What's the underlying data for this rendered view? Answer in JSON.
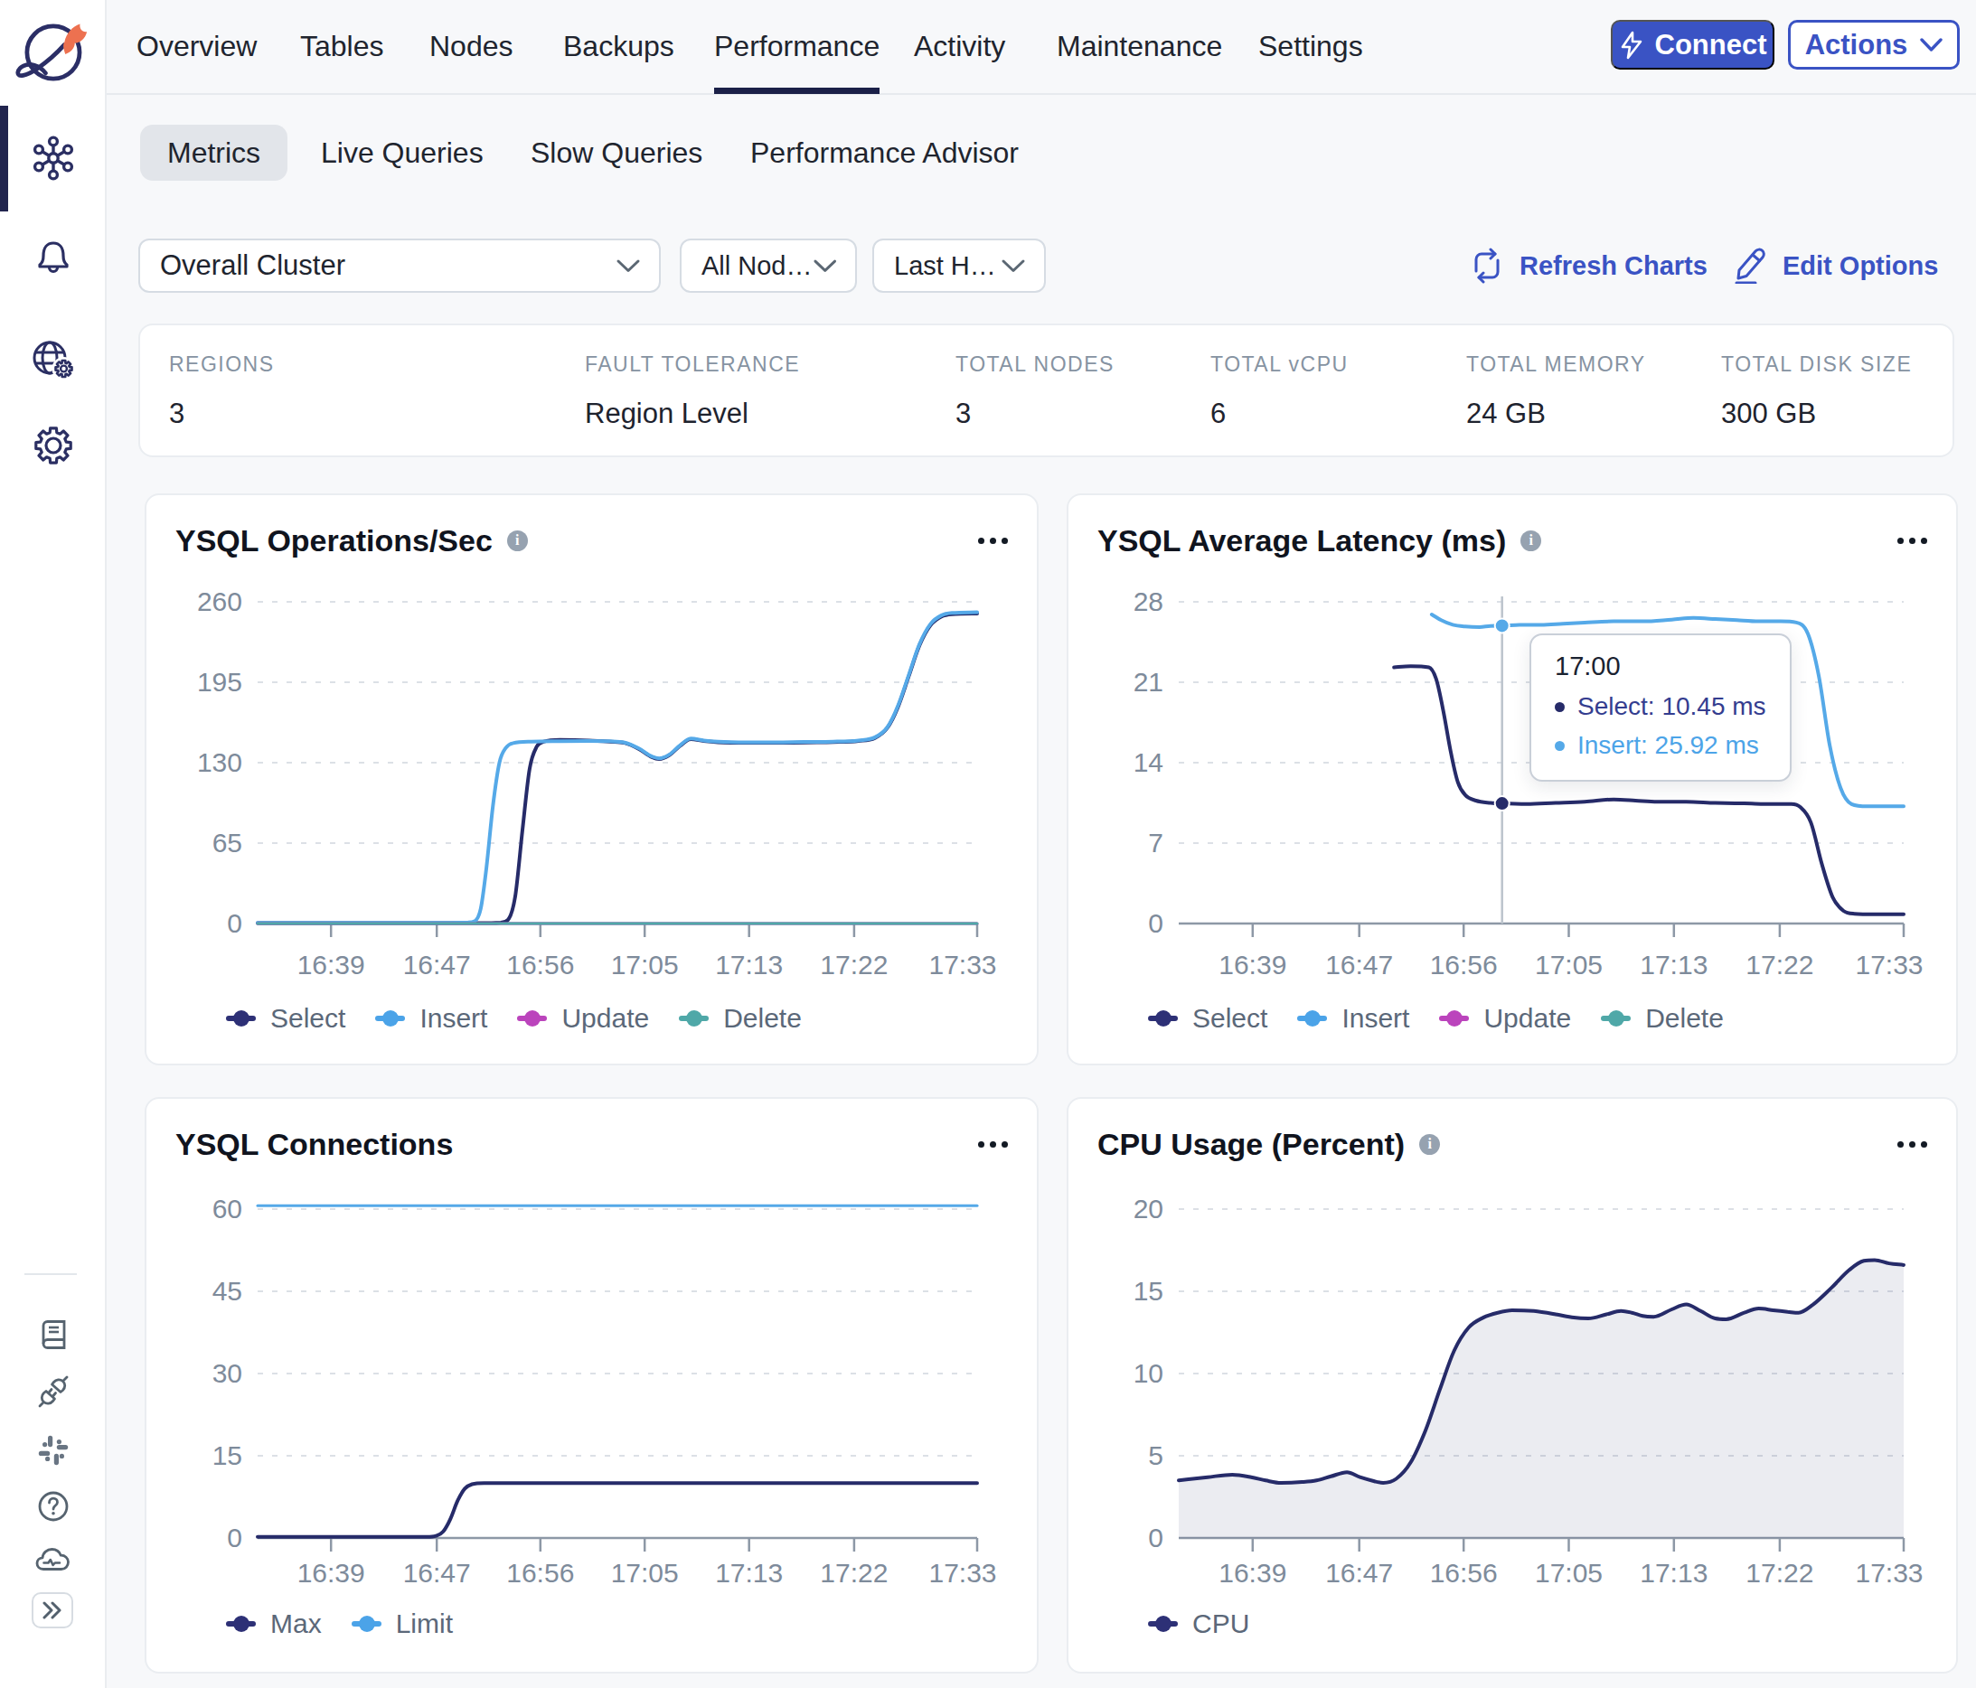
{
  "colors": {
    "accent": "#3A53C4",
    "underline": "#1B2048",
    "page_bg": "#F7F8FA",
    "navy": "#282D6E",
    "light_blue": "#4FA8E8",
    "magenta": "#BB44BC",
    "teal": "#4FA8A8",
    "axis": "#8D98A6",
    "grid": "#DCE0E6"
  },
  "sidebar": {
    "icons_top": [
      "cluster",
      "notifications",
      "network-settings",
      "settings"
    ],
    "icons_bottom": [
      "docs",
      "integrations",
      "slack",
      "help",
      "cloud-status"
    ],
    "expand_label": "expand"
  },
  "nav": {
    "tabs": [
      "Overview",
      "Tables",
      "Nodes",
      "Backups",
      "Performance",
      "Activity",
      "Maintenance",
      "Settings"
    ],
    "active_tab": "Performance",
    "connect_label": "Connect",
    "actions_label": "Actions"
  },
  "subtabs": {
    "items": [
      "Metrics",
      "Live Queries",
      "Slow Queries",
      "Performance Advisor"
    ],
    "active": "Metrics"
  },
  "filters": {
    "cluster_value": "Overall Cluster",
    "nodes_value": "All Nod…",
    "range_value": "Last H…",
    "refresh_label": "Refresh Charts",
    "edit_label": "Edit Options"
  },
  "stats": {
    "items": [
      {
        "label": "REGIONS",
        "value": "3"
      },
      {
        "label": "FAULT TOLERANCE",
        "value": "Region Level"
      },
      {
        "label": "TOTAL NODES",
        "value": "3"
      },
      {
        "label": "TOTAL vCPU",
        "value": "6"
      },
      {
        "label": "TOTAL MEMORY",
        "value": "24 GB"
      },
      {
        "label": "TOTAL DISK SIZE",
        "value": "300 GB"
      }
    ]
  },
  "chart_data": [
    {
      "id": "ysql-ops",
      "type": "line",
      "title": "YSQL Operations/Sec",
      "has_info": true,
      "y_max": 260,
      "y_ticks": [
        0,
        65,
        130,
        195,
        260
      ],
      "x_tick_labels": [
        "16:39",
        "16:47",
        "16:56",
        "17:05",
        "17:13",
        "17:22",
        "17:33"
      ],
      "x_tick_f": [
        0.102,
        0.249,
        0.393,
        0.538,
        0.683,
        0.829,
        1.0
      ],
      "legend": [
        {
          "label": "Select",
          "color": "#2D3076"
        },
        {
          "label": "Insert",
          "color": "#4BA3E8"
        },
        {
          "label": "Update",
          "color": "#BB44BC"
        },
        {
          "label": "Delete",
          "color": "#4FA8A8"
        }
      ],
      "series": [
        {
          "name": "Select",
          "color": "#262B69",
          "width": 4,
          "points": [
            [
              0,
              0.3
            ],
            [
              0.3,
              0.3
            ],
            [
              0.325,
              0.4
            ],
            [
              0.338,
              0.8
            ],
            [
              0.348,
              3
            ],
            [
              0.358,
              22
            ],
            [
              0.368,
              75
            ],
            [
              0.378,
              125
            ],
            [
              0.388,
              143
            ],
            [
              0.398,
              147
            ],
            [
              0.42,
              148.5
            ],
            [
              0.46,
              148
            ],
            [
              0.49,
              147
            ],
            [
              0.51,
              146
            ],
            [
              0.53,
              141
            ],
            [
              0.548,
              134.5
            ],
            [
              0.558,
              133
            ],
            [
              0.572,
              136
            ],
            [
              0.587,
              143.5
            ],
            [
              0.602,
              149
            ],
            [
              0.62,
              147.5
            ],
            [
              0.64,
              146.5
            ],
            [
              0.68,
              146
            ],
            [
              0.72,
              146
            ],
            [
              0.76,
              146.3
            ],
            [
              0.8,
              146.6
            ],
            [
              0.835,
              147.5
            ],
            [
              0.858,
              150
            ],
            [
              0.875,
              158
            ],
            [
              0.89,
              175
            ],
            [
              0.905,
              200
            ],
            [
              0.92,
              225
            ],
            [
              0.935,
              241
            ],
            [
              0.95,
              248
            ],
            [
              0.965,
              250
            ],
            [
              1.0,
              250.5
            ]
          ]
        },
        {
          "name": "Insert",
          "color": "#55A9E8",
          "width": 4,
          "points": [
            [
              0,
              0.5
            ],
            [
              0.26,
              0.5
            ],
            [
              0.292,
              0.8
            ],
            [
              0.302,
              2
            ],
            [
              0.31,
              12
            ],
            [
              0.318,
              45
            ],
            [
              0.327,
              95
            ],
            [
              0.336,
              130
            ],
            [
              0.345,
              142
            ],
            [
              0.355,
              145.8
            ],
            [
              0.38,
              147
            ],
            [
              0.42,
              147.3
            ],
            [
              0.46,
              147.5
            ],
            [
              0.49,
              147.3
            ],
            [
              0.51,
              146.3
            ],
            [
              0.53,
              141.5
            ],
            [
              0.548,
              135
            ],
            [
              0.558,
              133.5
            ],
            [
              0.572,
              136.5
            ],
            [
              0.587,
              144
            ],
            [
              0.602,
              149.5
            ],
            [
              0.62,
              148
            ],
            [
              0.64,
              147
            ],
            [
              0.68,
              146.5
            ],
            [
              0.72,
              146.5
            ],
            [
              0.76,
              146.8
            ],
            [
              0.8,
              147
            ],
            [
              0.835,
              148
            ],
            [
              0.858,
              150.5
            ],
            [
              0.875,
              158.5
            ],
            [
              0.89,
              176
            ],
            [
              0.905,
              201
            ],
            [
              0.92,
              226
            ],
            [
              0.935,
              242
            ],
            [
              0.95,
              249
            ],
            [
              0.965,
              251
            ],
            [
              1.0,
              251.5
            ]
          ]
        },
        {
          "name": "Update",
          "color": "#BB44BC",
          "width": 3,
          "points": [
            [
              0,
              0
            ],
            [
              1,
              0
            ]
          ]
        },
        {
          "name": "Delete",
          "color": "#4FA8A8",
          "width": 3,
          "points": [
            [
              0,
              0
            ],
            [
              1,
              0
            ]
          ]
        }
      ]
    },
    {
      "id": "ysql-latency",
      "type": "line",
      "title": "YSQL Average Latency (ms)",
      "has_info": true,
      "y_max": 28,
      "y_ticks": [
        0,
        7,
        14,
        21,
        28
      ],
      "x_tick_labels": [
        "16:39",
        "16:47",
        "16:56",
        "17:05",
        "17:13",
        "17:22",
        "17:33"
      ],
      "x_tick_f": [
        0.102,
        0.249,
        0.393,
        0.538,
        0.683,
        0.829,
        1.0
      ],
      "legend": [
        {
          "label": "Select",
          "color": "#2D3076"
        },
        {
          "label": "Insert",
          "color": "#4BA3E8"
        },
        {
          "label": "Update",
          "color": "#BB44BC"
        },
        {
          "label": "Delete",
          "color": "#4FA8A8"
        }
      ],
      "series": [
        {
          "name": "Select",
          "color": "#262B69",
          "width": 4,
          "points": [
            [
              0.297,
              22.3
            ],
            [
              0.32,
              22.4
            ],
            [
              0.345,
              22.3
            ],
            [
              0.355,
              21.3
            ],
            [
              0.365,
              18.5
            ],
            [
              0.375,
              15
            ],
            [
              0.385,
              12.3
            ],
            [
              0.395,
              11.2
            ],
            [
              0.41,
              10.7
            ],
            [
              0.43,
              10.5
            ],
            [
              0.446,
              10.45
            ],
            [
              0.48,
              10.4
            ],
            [
              0.52,
              10.5
            ],
            [
              0.56,
              10.6
            ],
            [
              0.6,
              10.8
            ],
            [
              0.63,
              10.7
            ],
            [
              0.66,
              10.6
            ],
            [
              0.7,
              10.6
            ],
            [
              0.74,
              10.5
            ],
            [
              0.78,
              10.45
            ],
            [
              0.82,
              10.4
            ],
            [
              0.845,
              10.4
            ],
            [
              0.858,
              10.1
            ],
            [
              0.872,
              8.8
            ],
            [
              0.887,
              5.2
            ],
            [
              0.902,
              2.3
            ],
            [
              0.917,
              1.1
            ],
            [
              0.932,
              0.85
            ],
            [
              0.96,
              0.8
            ],
            [
              1.0,
              0.8
            ]
          ]
        },
        {
          "name": "Insert",
          "color": "#55A9E8",
          "width": 4,
          "points": [
            [
              0.349,
              26.9
            ],
            [
              0.362,
              26.4
            ],
            [
              0.378,
              26.0
            ],
            [
              0.395,
              25.85
            ],
            [
              0.415,
              25.8
            ],
            [
              0.43,
              25.9
            ],
            [
              0.446,
              25.92
            ],
            [
              0.47,
              26.0
            ],
            [
              0.5,
              26.0
            ],
            [
              0.53,
              26.1
            ],
            [
              0.56,
              26.2
            ],
            [
              0.6,
              26.3
            ],
            [
              0.64,
              26.3
            ],
            [
              0.68,
              26.45
            ],
            [
              0.71,
              26.6
            ],
            [
              0.74,
              26.5
            ],
            [
              0.77,
              26.4
            ],
            [
              0.8,
              26.3
            ],
            [
              0.83,
              26.3
            ],
            [
              0.852,
              26.2
            ],
            [
              0.868,
              25.2
            ],
            [
              0.883,
              21.5
            ],
            [
              0.898,
              15.5
            ],
            [
              0.913,
              11.8
            ],
            [
              0.928,
              10.4
            ],
            [
              0.95,
              10.2
            ],
            [
              1.0,
              10.2
            ]
          ]
        }
      ],
      "cursor": {
        "f": 0.446,
        "tooltip_title": "17:00",
        "rows": [
          {
            "text": "Select: 10.45 ms",
            "color": "#343D8F",
            "value": 10.45,
            "dot": "#262B69"
          },
          {
            "text": "Insert: 25.92 ms",
            "color": "#4CA4E8",
            "value": 25.92,
            "dot": "#55A9E8"
          }
        ]
      }
    },
    {
      "id": "ysql-connections",
      "type": "line",
      "title": "YSQL Connections",
      "has_info": false,
      "y_max": 60,
      "y_ticks": [
        0,
        15,
        30,
        45,
        60
      ],
      "x_tick_labels": [
        "16:39",
        "16:47",
        "16:56",
        "17:05",
        "17:13",
        "17:22",
        "17:33"
      ],
      "x_tick_f": [
        0.102,
        0.249,
        0.393,
        0.538,
        0.683,
        0.829,
        1.0
      ],
      "legend": [
        {
          "label": "Max",
          "color": "#2D3076"
        },
        {
          "label": "Limit",
          "color": "#4BA3E8"
        }
      ],
      "series": [
        {
          "name": "Max",
          "color": "#262B69",
          "width": 4,
          "points": [
            [
              0,
              0.2
            ],
            [
              0.235,
              0.2
            ],
            [
              0.248,
              0.4
            ],
            [
              0.258,
              1.2
            ],
            [
              0.268,
              3.5
            ],
            [
              0.278,
              6.8
            ],
            [
              0.288,
              9.0
            ],
            [
              0.298,
              9.8
            ],
            [
              0.315,
              10
            ],
            [
              1.0,
              10
            ]
          ]
        },
        {
          "name": "Limit",
          "color": "#55A9E8",
          "width": 3,
          "points": [
            [
              0,
              60.6
            ],
            [
              1.0,
              60.6
            ]
          ]
        }
      ]
    },
    {
      "id": "cpu-usage",
      "type": "area",
      "title": "CPU Usage (Percent)",
      "has_info": true,
      "y_max": 20,
      "y_ticks": [
        0,
        5,
        10,
        15,
        20
      ],
      "x_tick_labels": [
        "16:39",
        "16:47",
        "16:56",
        "17:05",
        "17:13",
        "17:22",
        "17:33"
      ],
      "x_tick_f": [
        0.102,
        0.249,
        0.393,
        0.538,
        0.683,
        0.829,
        1.0
      ],
      "legend": [
        {
          "label": "CPU",
          "color": "#2D3076"
        }
      ],
      "series": [
        {
          "name": "CPU",
          "color": "#262B69",
          "width": 4,
          "area": "rgba(38,43,105,0.09)",
          "points": [
            [
              0,
              3.5
            ],
            [
              0.04,
              3.7
            ],
            [
              0.074,
              3.85
            ],
            [
              0.1,
              3.7
            ],
            [
              0.12,
              3.5
            ],
            [
              0.141,
              3.35
            ],
            [
              0.17,
              3.4
            ],
            [
              0.19,
              3.5
            ],
            [
              0.21,
              3.75
            ],
            [
              0.232,
              4.0
            ],
            [
              0.25,
              3.7
            ],
            [
              0.27,
              3.45
            ],
            [
              0.282,
              3.35
            ],
            [
              0.3,
              3.6
            ],
            [
              0.32,
              4.6
            ],
            [
              0.34,
              6.5
            ],
            [
              0.36,
              9.0
            ],
            [
              0.38,
              11.4
            ],
            [
              0.4,
              12.8
            ],
            [
              0.42,
              13.4
            ],
            [
              0.44,
              13.7
            ],
            [
              0.46,
              13.85
            ],
            [
              0.49,
              13.8
            ],
            [
              0.52,
              13.6
            ],
            [
              0.545,
              13.4
            ],
            [
              0.565,
              13.35
            ],
            [
              0.59,
              13.6
            ],
            [
              0.61,
              13.8
            ],
            [
              0.625,
              13.7
            ],
            [
              0.64,
              13.5
            ],
            [
              0.655,
              13.45
            ],
            [
              0.68,
              13.9
            ],
            [
              0.7,
              14.2
            ],
            [
              0.72,
              13.8
            ],
            [
              0.74,
              13.35
            ],
            [
              0.755,
              13.3
            ],
            [
              0.78,
              13.7
            ],
            [
              0.8,
              13.95
            ],
            [
              0.82,
              13.85
            ],
            [
              0.84,
              13.75
            ],
            [
              0.855,
              13.7
            ],
            [
              0.875,
              14.2
            ],
            [
              0.9,
              15.2
            ],
            [
              0.925,
              16.3
            ],
            [
              0.945,
              16.85
            ],
            [
              0.96,
              16.9
            ],
            [
              0.98,
              16.7
            ],
            [
              1.0,
              16.6
            ]
          ]
        }
      ]
    }
  ]
}
